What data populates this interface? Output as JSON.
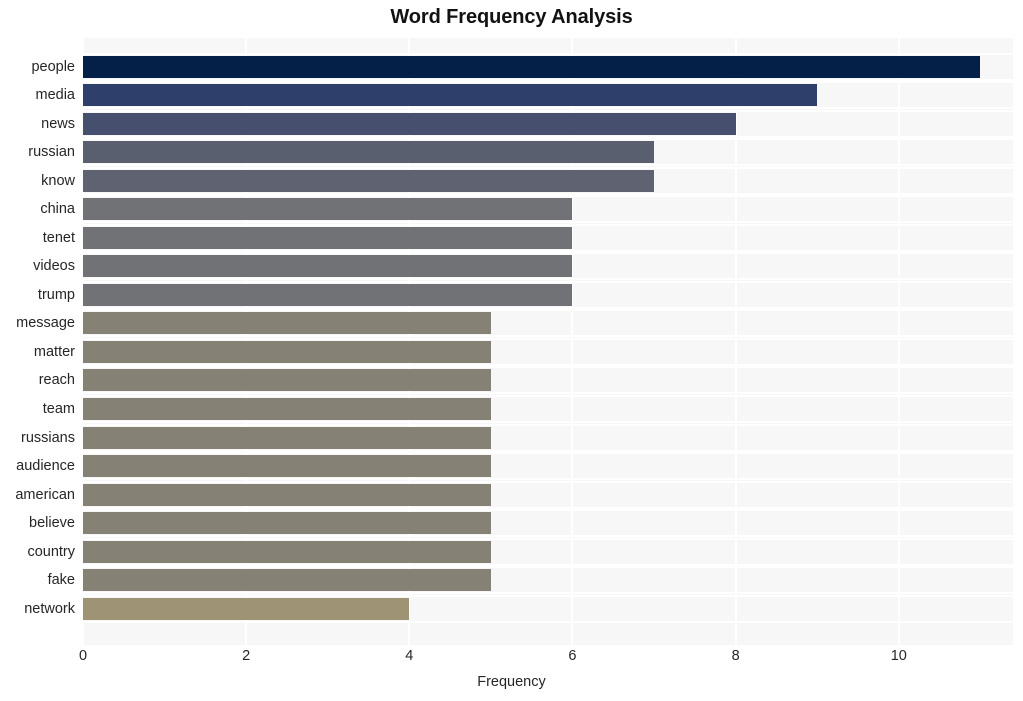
{
  "chart_data": {
    "type": "bar",
    "orientation": "horizontal",
    "title": "Word Frequency Analysis",
    "xlabel": "Frequency",
    "ylabel": "",
    "xlim": [
      0,
      11.4
    ],
    "xticks": [
      0,
      2,
      4,
      6,
      8,
      10
    ],
    "xtick_labels": [
      "0",
      "2",
      "4",
      "6",
      "8",
      "10"
    ],
    "grid": true,
    "grid_color": "#ffffff",
    "plot_background": "#f7f7f7",
    "legend": null,
    "categories": [
      "people",
      "media",
      "news",
      "russian",
      "know",
      "china",
      "tenet",
      "videos",
      "trump",
      "message",
      "matter",
      "reach",
      "team",
      "russians",
      "audience",
      "american",
      "believe",
      "country",
      "fake",
      "network"
    ],
    "values": [
      11,
      9,
      8,
      7,
      7,
      6,
      6,
      6,
      6,
      5,
      5,
      5,
      5,
      5,
      5,
      5,
      5,
      5,
      5,
      4
    ],
    "bar_colors": [
      "#042049",
      "#2e3f6b",
      "#474f6e",
      "#5a5f6f",
      "#5e6271",
      "#717276",
      "#717276",
      "#717276",
      "#717276",
      "#858275",
      "#858275",
      "#858275",
      "#858275",
      "#858275",
      "#858275",
      "#858275",
      "#858275",
      "#858275",
      "#858275",
      "#9e9374"
    ]
  }
}
